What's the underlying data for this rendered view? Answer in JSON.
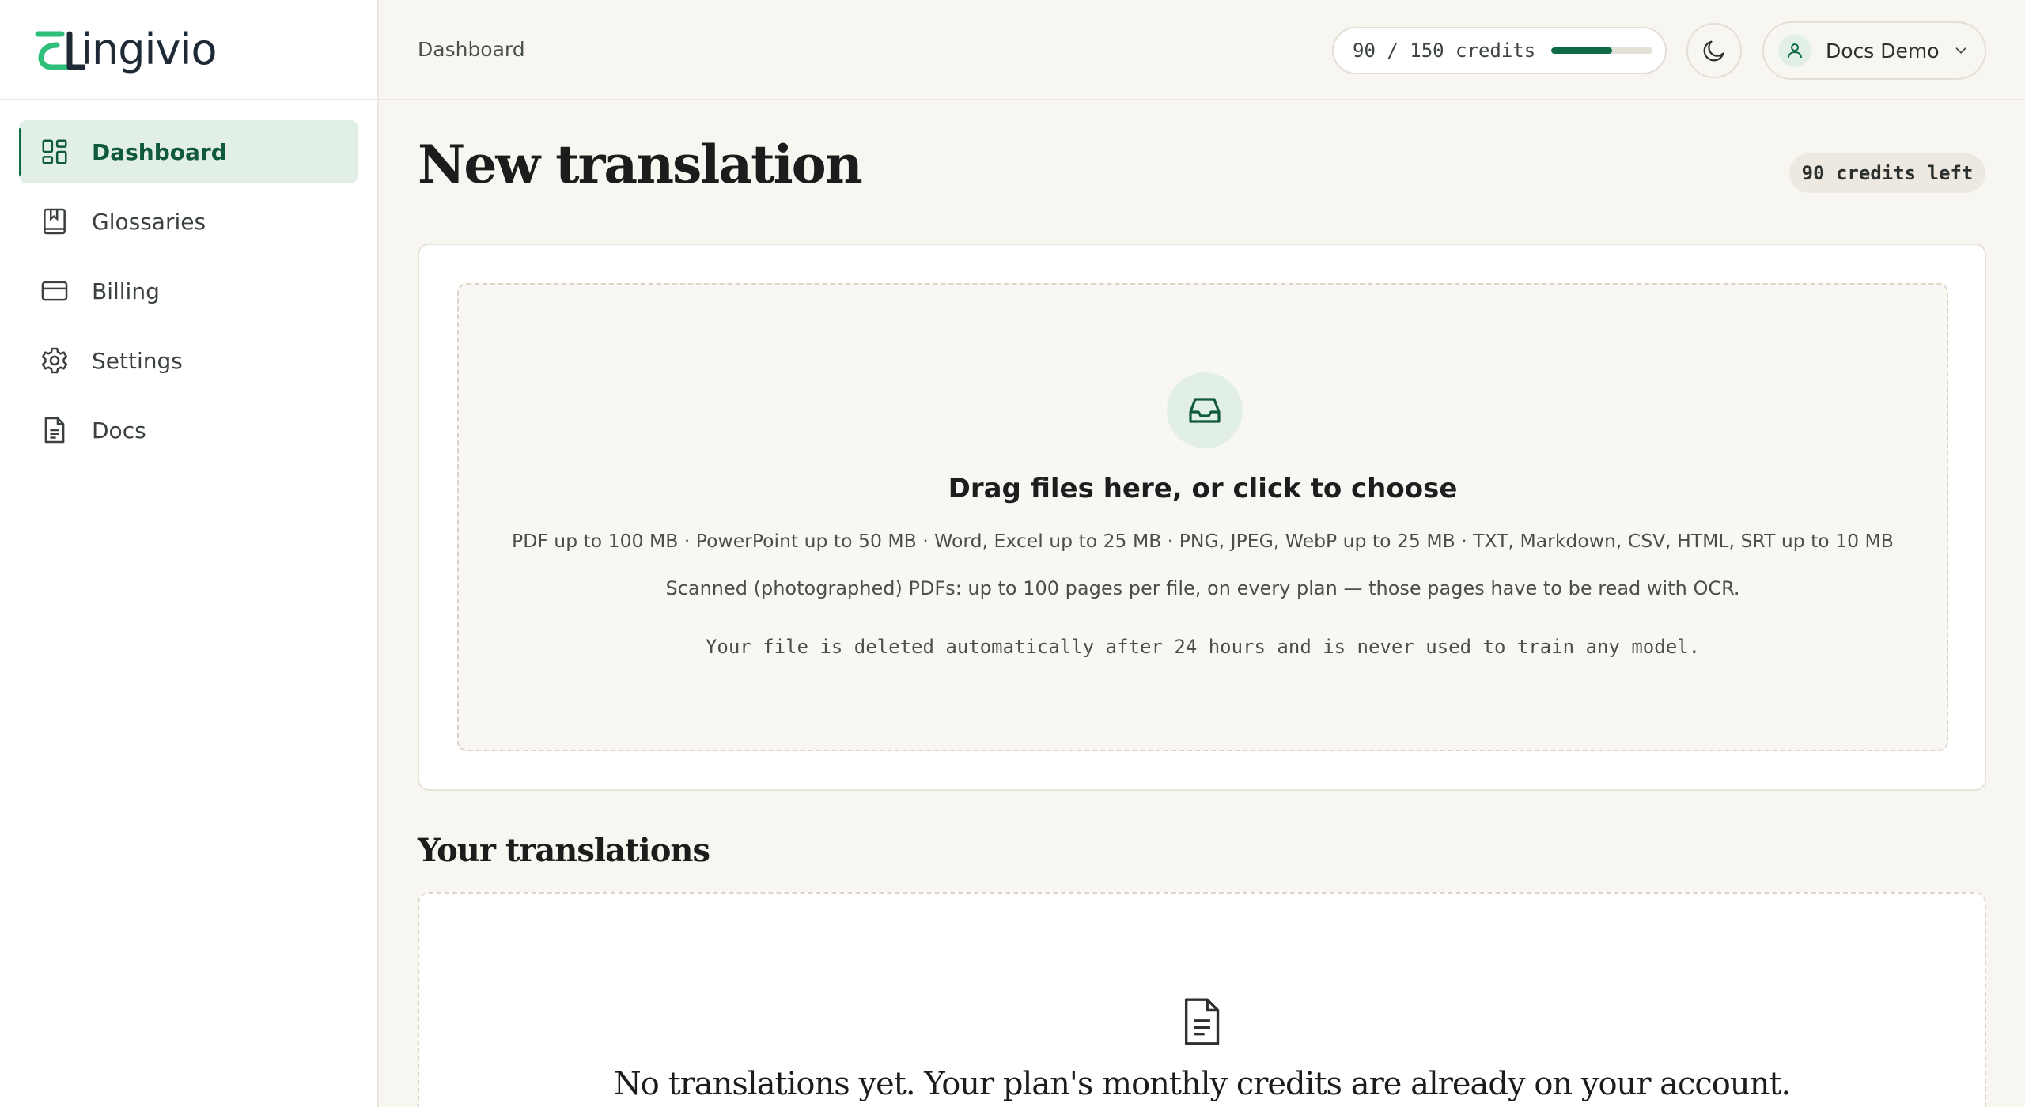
{
  "app": {
    "brand_name": "Lingivio",
    "brand_text": "ingivio",
    "logo_icon": "brand-logo-icon"
  },
  "sidebar": {
    "items": [
      {
        "label": "Dashboard",
        "icon": "dashboard-grid-icon",
        "active": true
      },
      {
        "label": "Glossaries",
        "icon": "bookmark-book-icon",
        "active": false
      },
      {
        "label": "Billing",
        "icon": "credit-card-icon",
        "active": false
      },
      {
        "label": "Settings",
        "icon": "gear-icon",
        "active": false
      },
      {
        "label": "Docs",
        "icon": "document-icon",
        "active": false
      }
    ]
  },
  "header": {
    "breadcrumb": "Dashboard",
    "credits_text": "90 / 150 credits",
    "credits_used": 90,
    "credits_total": 150,
    "theme_toggle_icon": "moon-icon",
    "user": {
      "name": "Docs Demo",
      "avatar_icon": "user-icon",
      "menu_icon": "chevron-down-icon"
    }
  },
  "main": {
    "title": "New translation",
    "credits_left": "90 credits left",
    "upload": {
      "icon": "inbox-icon",
      "heading": "Drag files here, or click to choose",
      "formats": "PDF up to 100 MB · PowerPoint up to 50 MB · Word, Excel up to 25 MB · PNG, JPEG, WebP up to 25 MB · TXT, Markdown, CSV, HTML, SRT up to 10 MB",
      "scanned_note": "Scanned (photographed) PDFs: up to 100 pages per file, on every plan — those pages have to be read with OCR.",
      "privacy_note": "Your file is deleted automatically after 24 hours and is never used to train any model."
    },
    "translations": {
      "title": "Your translations",
      "empty_icon": "document-icon",
      "empty_text": "No translations yet. Your plan's monthly credits are already on your account."
    }
  },
  "colors": {
    "accent": "#0f6b45",
    "accent_soft": "#e2efe7",
    "background": "#f8f6f1",
    "surface": "#ffffff",
    "border": "#ebe7de"
  }
}
